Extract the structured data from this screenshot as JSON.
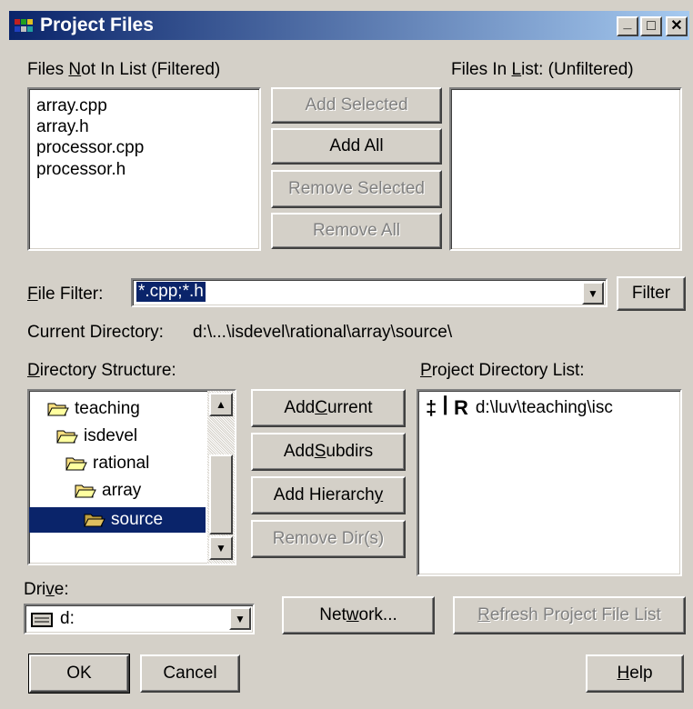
{
  "window": {
    "title": "Project Files"
  },
  "titlebar_buttons": {
    "minimize": "_",
    "maximize": "□",
    "close": "✕"
  },
  "files_not_in_list": {
    "label_pre": "Files ",
    "label_ul": "N",
    "label_post": "ot In List (Filtered)",
    "items": [
      "array.cpp",
      "array.h",
      "processor.cpp",
      "processor.h"
    ]
  },
  "files_in_list": {
    "label_pre": "Files In ",
    "label_ul": "L",
    "label_post": "ist: (Unfiltered)"
  },
  "buttons": {
    "add_selected": "Add Selected",
    "add_all": "Add All",
    "remove_selected": "Remove Selected",
    "remove_all": "Remove All",
    "filter": "Filter",
    "add_current_pre": "Add ",
    "add_current_ul": "C",
    "add_current_post": "urrent",
    "add_subdirs_pre": "Add ",
    "add_subdirs_ul": "S",
    "add_subdirs_post": "ubdirs",
    "add_hierarchy_pre": "Add Hierarch",
    "add_hierarchy_ul": "y",
    "add_hierarchy_post": "",
    "remove_dirs": "Remove Dir(s)",
    "network_pre": "Net",
    "network_ul": "w",
    "network_post": "ork...",
    "refresh_pre": "",
    "refresh_ul": "R",
    "refresh_post": "efresh Project File List",
    "ok": "OK",
    "cancel": "Cancel",
    "help_pre": "",
    "help_ul": "H",
    "help_post": "elp"
  },
  "file_filter": {
    "label_pre": "",
    "label_ul": "F",
    "label_post": "ile Filter:",
    "value": "*.cpp;*.h"
  },
  "current_directory": {
    "label": "Current Directory:",
    "value": "d:\\...\\isdevel\\rational\\array\\source\\"
  },
  "directory_structure": {
    "label_pre": "",
    "label_ul": "D",
    "label_post": "irectory Structure:",
    "items": [
      "teaching",
      "isdevel",
      "rational",
      "array",
      "source"
    ],
    "selected": "source"
  },
  "project_directory_list": {
    "label_pre": "",
    "label_ul": "P",
    "label_post": "roject Directory List:",
    "entry_flags": "‡ ꟾ R",
    "entry_path": "d:\\luv\\teaching\\isc"
  },
  "drive": {
    "label_pre": "Dri",
    "label_ul": "v",
    "label_post": "e:",
    "value": "d:"
  },
  "colors": {
    "title_start": "#0a246a",
    "title_end": "#a6caf0",
    "selection": "#0a246a",
    "face": "#d4d0c8",
    "folder": "#f8e080"
  }
}
